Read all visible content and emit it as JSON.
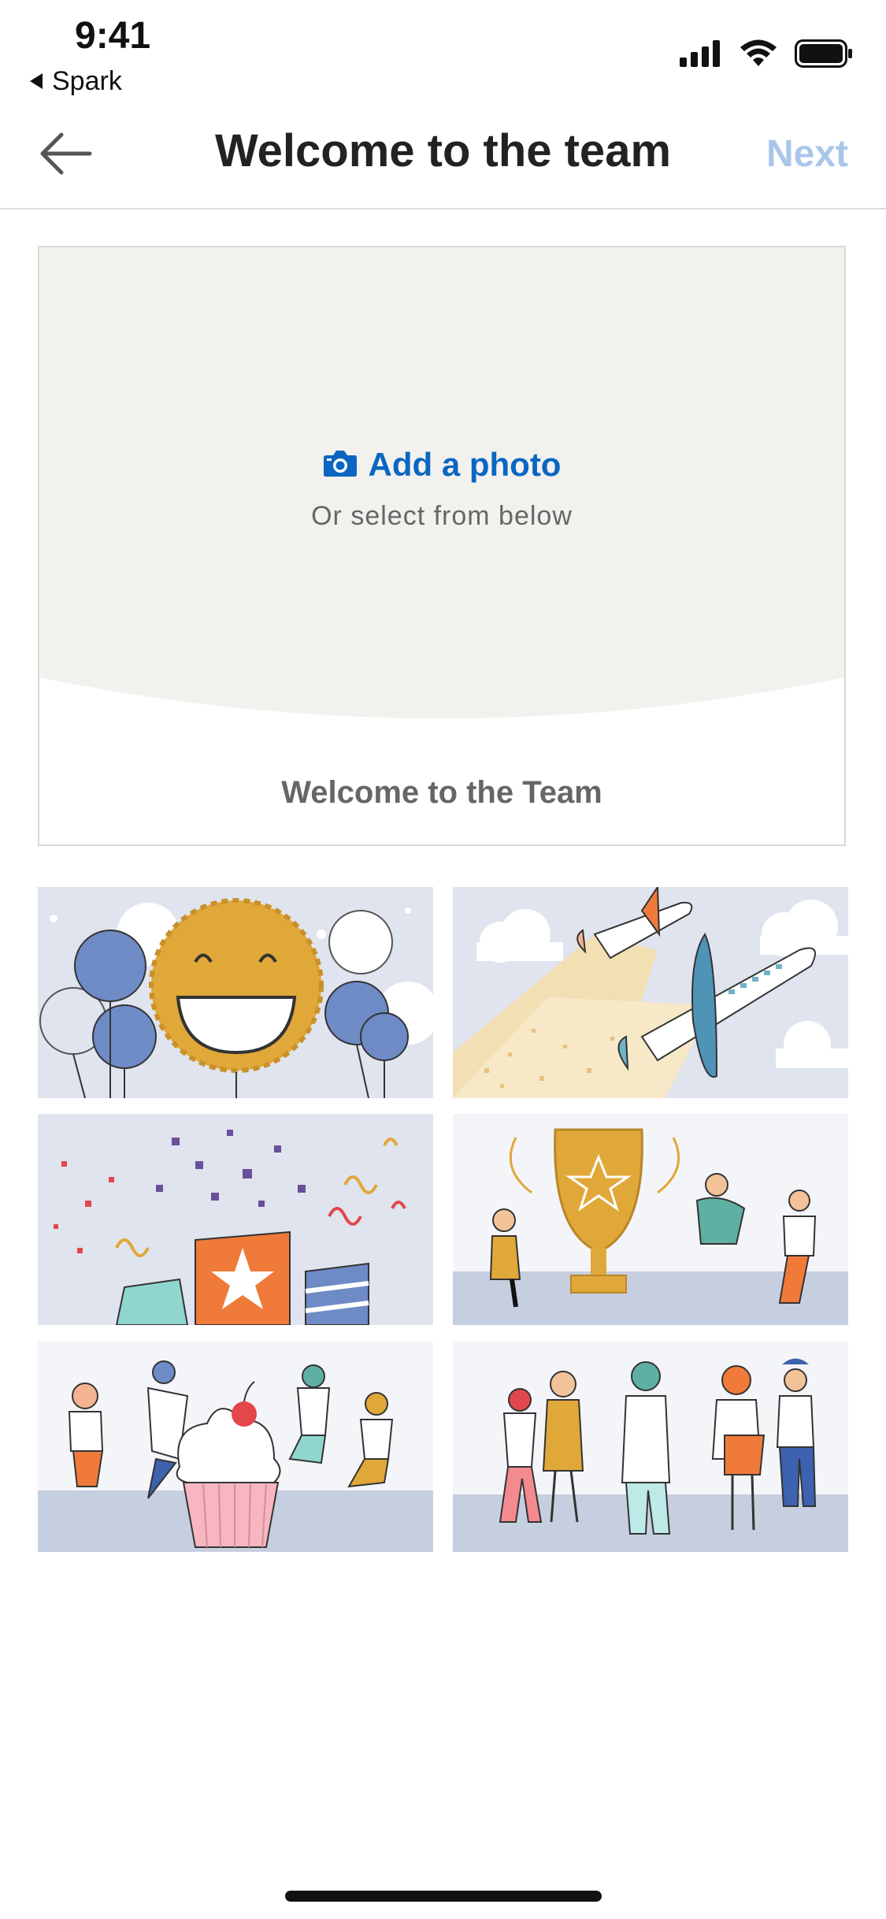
{
  "status_bar": {
    "time": "9:41",
    "back_app": "Spark"
  },
  "nav": {
    "title": "Welcome to the team",
    "next_label": "Next"
  },
  "preview": {
    "add_photo_label": "Add a photo",
    "select_hint": "Or select from below",
    "card_title": "Welcome to the Team"
  },
  "templates": [
    {
      "name": "balloons"
    },
    {
      "name": "airplanes"
    },
    {
      "name": "confetti"
    },
    {
      "name": "trophy"
    },
    {
      "name": "cupcake"
    },
    {
      "name": "team"
    }
  ],
  "colors": {
    "accent": "#0a66c2",
    "next_disabled": "#a9c6ea",
    "photo_bg": "#f2f1ee",
    "tile_bg": "#dfe4ee"
  }
}
